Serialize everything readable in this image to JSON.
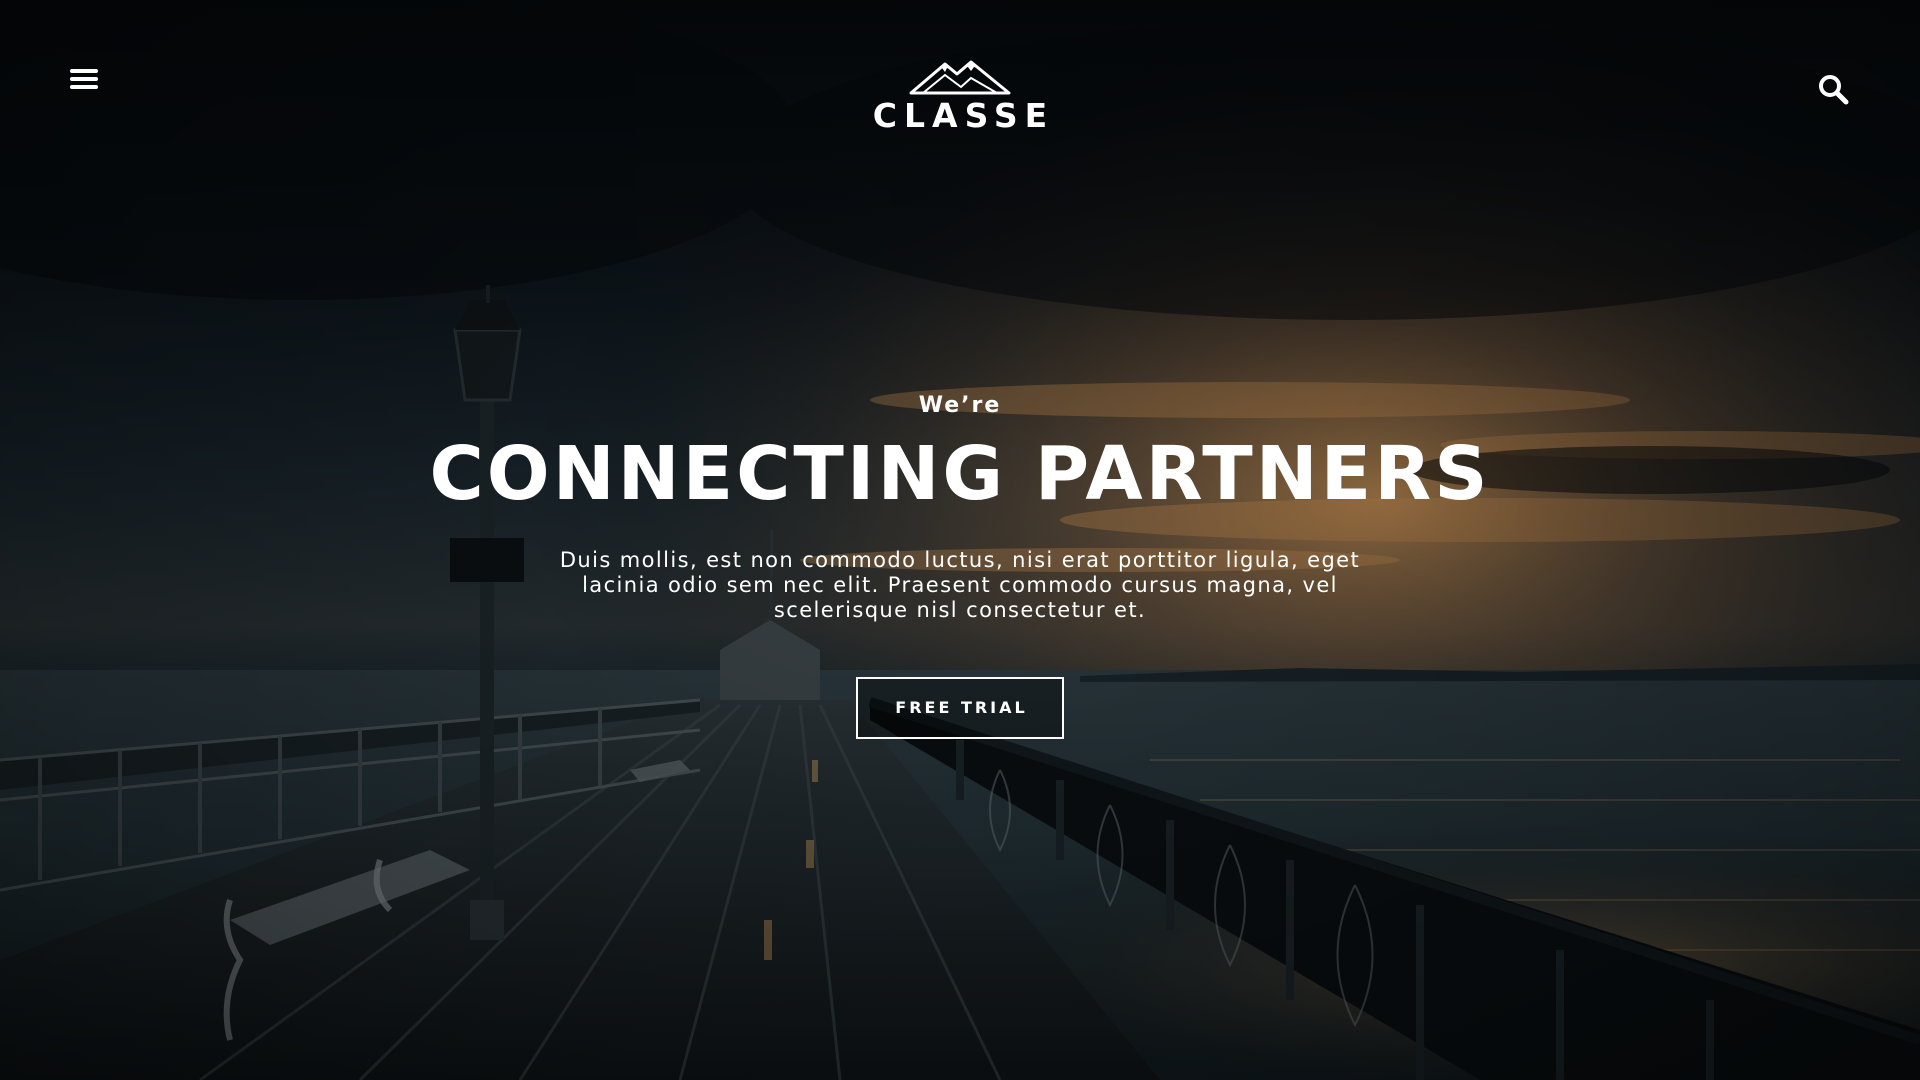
{
  "header": {
    "menu_icon": "hamburger-menu-icon",
    "logo_icon": "mountain-logo-icon",
    "logo_text": "CLASSE",
    "search_icon": "search-icon"
  },
  "hero": {
    "eyebrow": "We’re",
    "headline": "CONNECTING PARTNERS",
    "subtitle": "Duis mollis, est non commodo luctus, nisi erat porttitor ligula, eget lacinia odio sem nec elit. Praesent commodo cursus magna, vel scelerisque nisl consectetur et.",
    "cta_label": "FREE TRIAL"
  },
  "colors": {
    "text": "#ffffff",
    "sky_dark": "#0b1117",
    "sunset_glow": "#c98a4a",
    "sea": "#1f2f36"
  }
}
